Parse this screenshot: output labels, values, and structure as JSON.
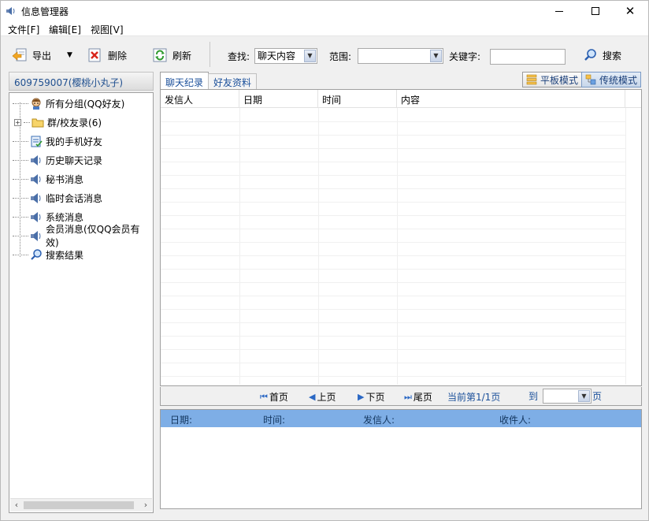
{
  "window": {
    "title": "信息管理器",
    "controls": {
      "minimize": "—",
      "maximize": "☐",
      "close": "✕"
    }
  },
  "menu": [
    "文件[F]",
    "编辑[E]",
    "视图[V]"
  ],
  "toolbar": {
    "export_label": "导出",
    "delete_label": "删除",
    "refresh_label": "刷新",
    "search_by_label": "查找:",
    "search_by_value": "聊天内容",
    "range_label": "范围:",
    "range_value": "",
    "keyword_label": "关键字:",
    "keyword_value": "",
    "search_label": "搜索"
  },
  "account": "609759007(樱桃小丸子)",
  "tree": [
    {
      "label": "所有分组(QQ好友)",
      "icon": "friends-icon"
    },
    {
      "label": "群/校友录(6)",
      "icon": "folder-icon",
      "expandable": true
    },
    {
      "label": "我的手机好友",
      "icon": "mobile-contacts-icon"
    },
    {
      "label": "历史聊天记录",
      "icon": "speaker-icon"
    },
    {
      "label": "秘书消息",
      "icon": "speaker-icon"
    },
    {
      "label": "临时会话消息",
      "icon": "speaker-icon"
    },
    {
      "label": "系统消息",
      "icon": "speaker-icon"
    },
    {
      "label": "会员消息(仅QQ会员有效)",
      "icon": "speaker-icon"
    },
    {
      "label": "搜索结果",
      "icon": "magnifier-icon"
    }
  ],
  "tabs": [
    "聊天纪录",
    "好友资料"
  ],
  "modes": {
    "flat": "平板模式",
    "classic": "传统模式"
  },
  "grid": {
    "columns": [
      "发信人",
      "日期",
      "时间",
      "内容"
    ]
  },
  "pager": {
    "first": "首页",
    "prev": "上页",
    "next": "下页",
    "last": "尾页",
    "info": "当前第1/1页",
    "goto_prefix": "到",
    "goto_suffix": "页",
    "goto_value": ""
  },
  "detail": {
    "date": "日期:",
    "time": "时间:",
    "sender": "发信人:",
    "receiver": "收件人:"
  },
  "colors": {
    "accent_blue": "#1a4f9a",
    "detail_header": "#7eaee6"
  }
}
